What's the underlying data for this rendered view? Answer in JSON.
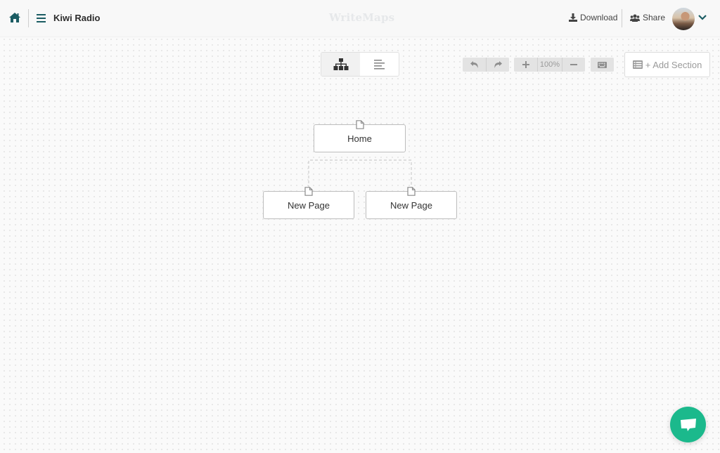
{
  "header": {
    "project_title": "Kiwi Radio",
    "brand": "WriteMaps",
    "download_label": "Download",
    "share_label": "Share"
  },
  "toolbar": {
    "view_modes": [
      {
        "name": "sitemap-tree-view",
        "active": true
      },
      {
        "name": "outline-list-view",
        "active": false
      }
    ],
    "zoom_level": "100%",
    "add_section_label": "+ Add Section"
  },
  "sitemap": {
    "root": {
      "label": "Home"
    },
    "children": [
      {
        "label": "New Page"
      },
      {
        "label": "New Page"
      }
    ]
  },
  "colors": {
    "accent": "#1b5c63",
    "chat": "#1bb98c"
  }
}
